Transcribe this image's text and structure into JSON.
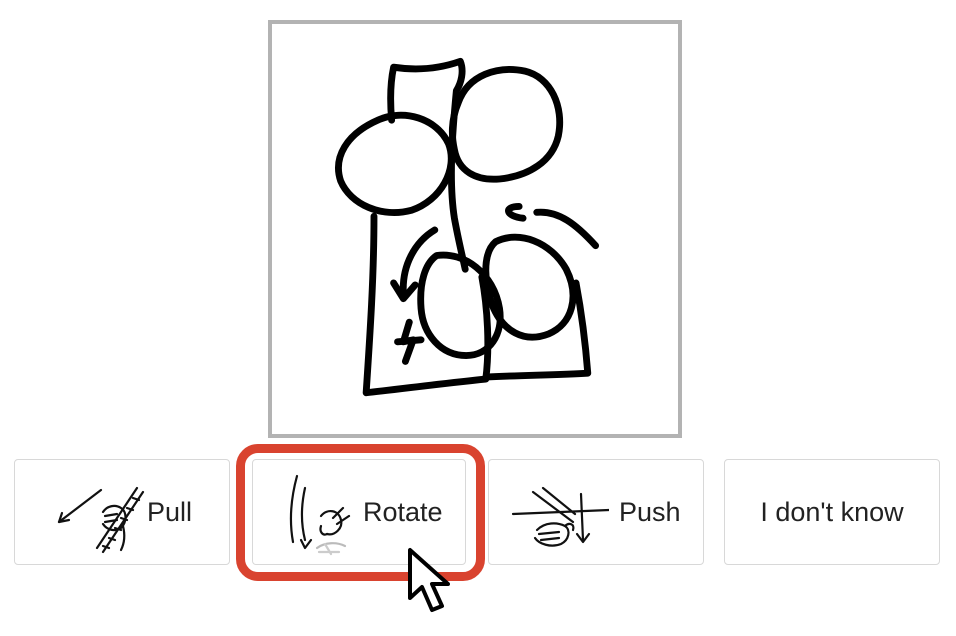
{
  "options": [
    {
      "label": "Pull",
      "icon": "pull-rope-icon"
    },
    {
      "label": "Rotate",
      "icon": "rotate-knob-icon",
      "selected": true
    },
    {
      "label": "Push",
      "icon": "push-hand-icon"
    },
    {
      "label": "I don't know"
    }
  ],
  "colors": {
    "selection_ring": "#d9432f",
    "frame_border": "#b3b3b3",
    "option_border": "#d8d8d8",
    "sketch_stroke": "#000000"
  }
}
